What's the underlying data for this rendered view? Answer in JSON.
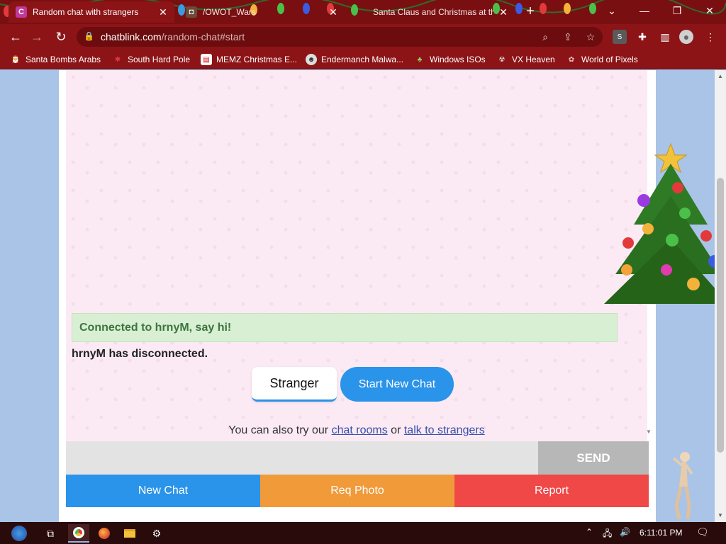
{
  "browser": {
    "tabs": [
      {
        "title": "Random chat with strangers",
        "favicon": "C",
        "favicon_color": "#c0399a",
        "active": true
      },
      {
        "title": "/OWOT_Wars",
        "favicon": "owot-icon",
        "active": false
      },
      {
        "title": "Santa Claus and Christmas at the",
        "favicon": "globe-icon",
        "active": false
      }
    ],
    "url_host": "chatblink.com",
    "url_path": "/random-chat#start",
    "bookmarks": [
      {
        "label": "Santa Bombs Arabs"
      },
      {
        "label": "South Hard Pole"
      },
      {
        "label": "MEMZ Christmas E..."
      },
      {
        "label": "Endermanch Malwa..."
      },
      {
        "label": "Windows ISOs"
      },
      {
        "label": "VX Heaven"
      },
      {
        "label": "World of Pixels"
      }
    ],
    "ext_badge": "S"
  },
  "chat": {
    "connected_text": "Connected to hrnyM, say hi!",
    "disconnected_text": "hrnyM has disconnected.",
    "stranger_label": "Stranger",
    "start_new_label": "Start New Chat",
    "also_prefix": "You can also try our",
    "chat_rooms_link": "chat rooms",
    "or_text": "or",
    "talk_link": "talk to strangers",
    "message_placeholder": "",
    "send_label": "SEND",
    "actions": {
      "new_chat": "New Chat",
      "req_photo": "Req Photo",
      "report": "Report"
    }
  },
  "taskbar": {
    "time": "6:11:01 PM"
  },
  "colors": {
    "chrome_red": "#8c1417",
    "accent_blue": "#2a93ea",
    "orange": "#f09a3a",
    "red": "#f04747",
    "success_green": "#d9efd4"
  }
}
